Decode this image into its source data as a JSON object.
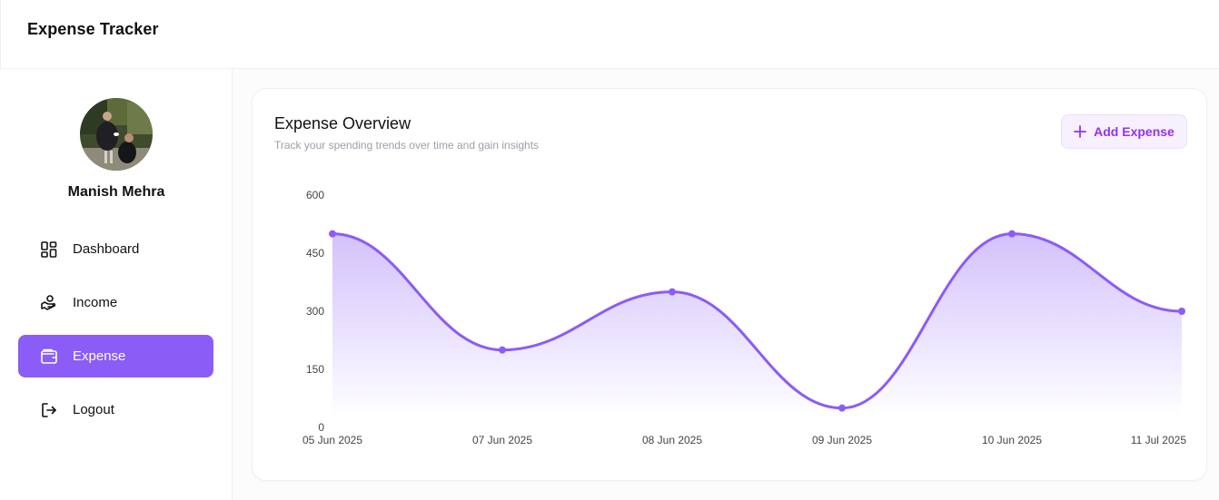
{
  "app": {
    "title": "Expense Tracker"
  },
  "user": {
    "name": "Manish Mehra"
  },
  "sidebar": {
    "items": [
      {
        "label": "Dashboard",
        "icon": "dashboard-icon",
        "active": false
      },
      {
        "label": "Income",
        "icon": "income-hand-icon",
        "active": false
      },
      {
        "label": "Expense",
        "icon": "wallet-icon",
        "active": true
      },
      {
        "label": "Logout",
        "icon": "logout-icon",
        "active": false
      }
    ]
  },
  "overview": {
    "title": "Expense Overview",
    "subtitle": "Track your spending trends over time and gain insights",
    "add_button_label": "Add Expense",
    "add_button_icon": "plus-icon"
  },
  "colors": {
    "accent": "#8b5cf6",
    "add_button_text": "#9333ea",
    "add_button_bg": "#f7f0fe"
  },
  "chart_data": {
    "type": "area",
    "categories": [
      "05 Jun 2025",
      "07 Jun 2025",
      "08 Jun 2025",
      "09 Jun 2025",
      "10 Jun 2025",
      "11 Jul 2025"
    ],
    "values": [
      500,
      200,
      350,
      50,
      500,
      300
    ],
    "yticks": [
      0,
      150,
      300,
      450,
      600
    ],
    "ylim": [
      0,
      600
    ],
    "grid": false,
    "legend": "none",
    "color": "#8b5cf6"
  }
}
